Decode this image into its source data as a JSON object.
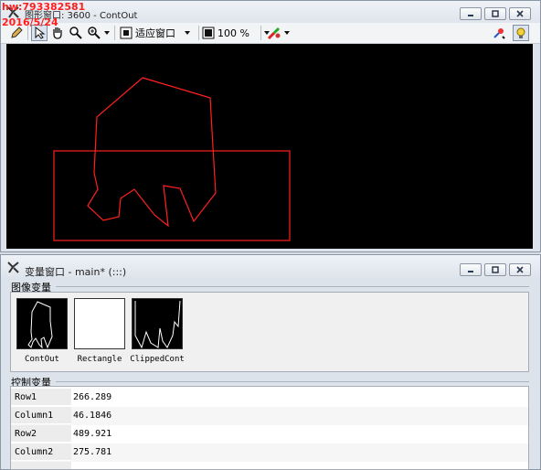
{
  "watermark": {
    "line1": "hw:793382581",
    "line2": "2016/5/24"
  },
  "graphics_window": {
    "title": "图形窗口: 3600 - ContOut",
    "toolbar": {
      "fit_label": "适应窗口",
      "zoom_label": "100 %"
    }
  },
  "variable_window": {
    "title": "变量窗口 - main* (:::)",
    "image_section_label": "图像变量",
    "control_section_label": "控制变量",
    "images": [
      {
        "name": "ContOut"
      },
      {
        "name": "Rectangle"
      },
      {
        "name": "ClippedCont"
      }
    ],
    "controls": [
      {
        "name": "Row1",
        "value": "266.289"
      },
      {
        "name": "Column1",
        "value": "46.1846"
      },
      {
        "name": "Row2",
        "value": "489.921"
      },
      {
        "name": "Column2",
        "value": "275.781"
      }
    ]
  },
  "colors": {
    "contour": "#ff2020",
    "canvas_bg": "#000000",
    "watermark": "#ff1f1f"
  }
}
